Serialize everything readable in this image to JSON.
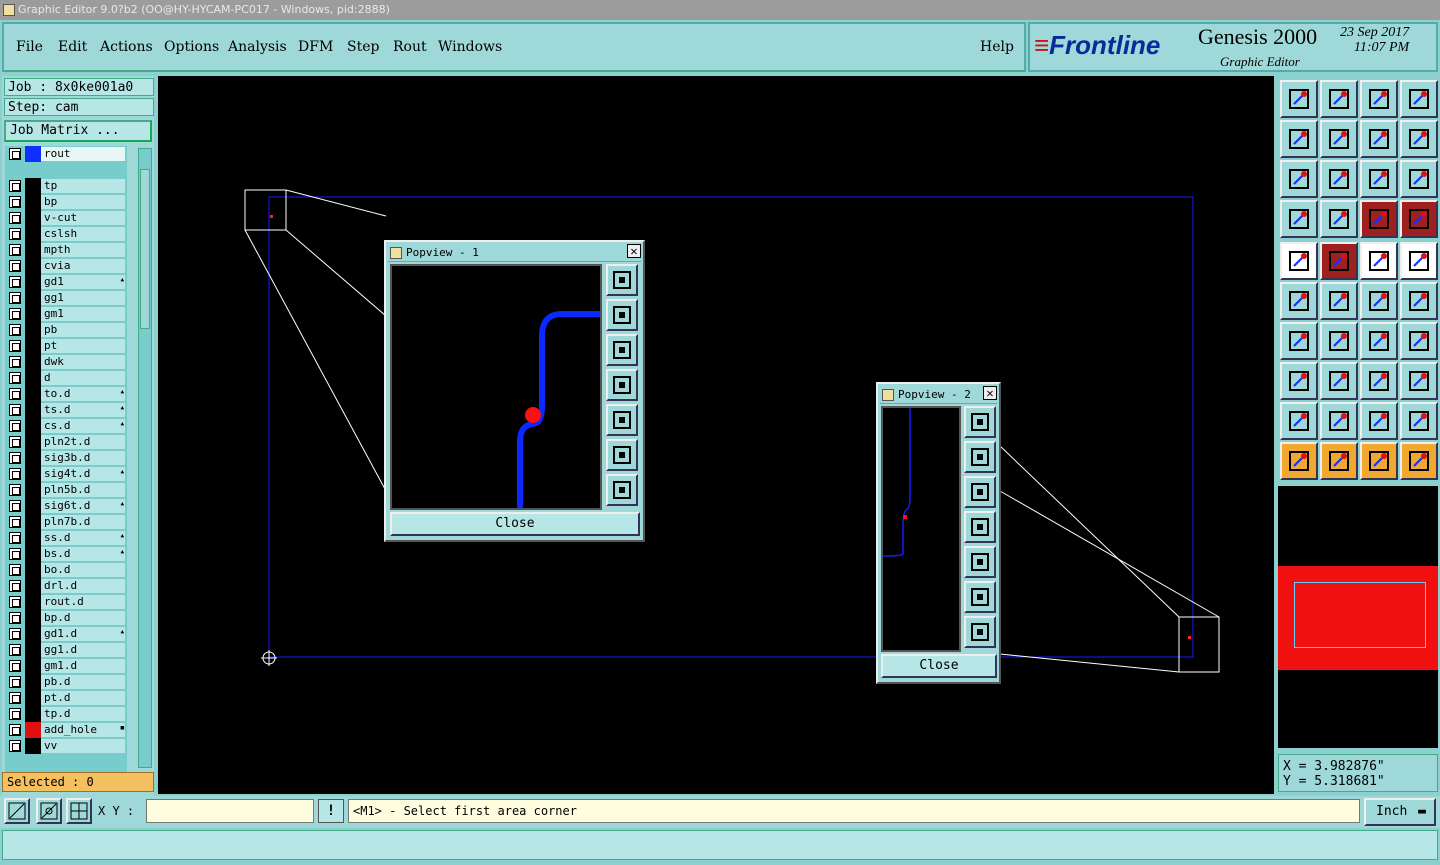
{
  "window": {
    "title": "Graphic Editor 9.0?b2 (OO@HY-HYCAM-PC017 - Windows, pid:2888)"
  },
  "menu": {
    "file": "File",
    "edit": "Edit",
    "actions": "Actions",
    "options": "Options",
    "analysis": "Analysis",
    "dfm": "DFM",
    "step": "Step",
    "rout": "Rout",
    "windows": "Windows",
    "help": "Help"
  },
  "branding": {
    "company": "Frontline",
    "product": "Genesis 2000",
    "subtitle": "Graphic Editor",
    "date": "23 Sep 2017",
    "time": "11:07 PM"
  },
  "job": {
    "job_label": "Job : 8x0ke001a0",
    "step_label": "Step: cam",
    "matrix_button": "Job Matrix ..."
  },
  "layers": [
    {
      "name": "rout",
      "color": "#1030ff",
      "active": true
    },
    {
      "name": "tp",
      "color": "#000000"
    },
    {
      "name": "bp",
      "color": "#000000"
    },
    {
      "name": "v-cut",
      "color": "#000000"
    },
    {
      "name": "cslsh",
      "color": "#000000"
    },
    {
      "name": "mpth",
      "color": "#000000"
    },
    {
      "name": "cvia",
      "color": "#000000"
    },
    {
      "name": "gd1",
      "color": "#000000",
      "mark": "▴"
    },
    {
      "name": "gg1",
      "color": "#000000"
    },
    {
      "name": "gm1",
      "color": "#000000"
    },
    {
      "name": "pb",
      "color": "#000000"
    },
    {
      "name": "pt",
      "color": "#000000"
    },
    {
      "name": "dwk",
      "color": "#000000"
    },
    {
      "name": "d",
      "color": "#000000"
    },
    {
      "name": "to.d",
      "color": "#000000",
      "mark": "▴"
    },
    {
      "name": "ts.d",
      "color": "#000000",
      "mark": "▴"
    },
    {
      "name": "cs.d",
      "color": "#000000",
      "mark": "▴"
    },
    {
      "name": "pln2t.d",
      "color": "#000000"
    },
    {
      "name": "sig3b.d",
      "color": "#000000"
    },
    {
      "name": "sig4t.d",
      "color": "#000000",
      "mark": "▴"
    },
    {
      "name": "pln5b.d",
      "color": "#000000"
    },
    {
      "name": "sig6t.d",
      "color": "#000000",
      "mark": "▴"
    },
    {
      "name": "pln7b.d",
      "color": "#000000"
    },
    {
      "name": "ss.d",
      "color": "#000000",
      "mark": "▴"
    },
    {
      "name": "bs.d",
      "color": "#000000",
      "mark": "▴"
    },
    {
      "name": "bo.d",
      "color": "#000000"
    },
    {
      "name": "drl.d",
      "color": "#000000"
    },
    {
      "name": "rout.d",
      "color": "#000000"
    },
    {
      "name": "bp.d",
      "color": "#000000"
    },
    {
      "name": "gd1.d",
      "color": "#000000",
      "mark": "▴"
    },
    {
      "name": "gg1.d",
      "color": "#000000"
    },
    {
      "name": "gm1.d",
      "color": "#000000"
    },
    {
      "name": "pb.d",
      "color": "#000000"
    },
    {
      "name": "pt.d",
      "color": "#000000"
    },
    {
      "name": "tp.d",
      "color": "#000000"
    },
    {
      "name": "add_hole",
      "color": "#e01010",
      "mark": "▪"
    },
    {
      "name": "vv",
      "color": "#000000"
    }
  ],
  "selected": {
    "label": "Selected : 0"
  },
  "popview1": {
    "title": "Popview - 1",
    "close_label": "Close"
  },
  "popview2": {
    "title": "Popview - 2",
    "close_label": "Close"
  },
  "coords": {
    "x_label": "X = 3.982876\"",
    "y_label": "Y = 5.318681\""
  },
  "bottom": {
    "xy_label": "X Y :",
    "xy_value": "",
    "excl": "!",
    "message": "<M1> - Select first area corner",
    "unit": "Inch"
  },
  "colors": {
    "panel": "#9ed8d8",
    "canvas": "#000000",
    "outline": "#1a1aff",
    "trace": "#0a28ff",
    "pad": "#ff1010"
  }
}
